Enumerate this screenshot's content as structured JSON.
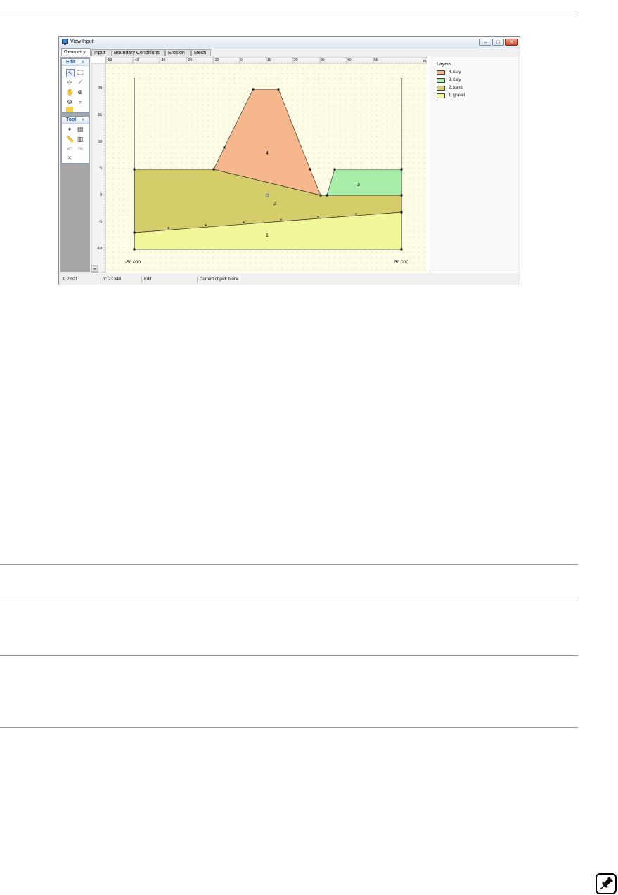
{
  "window": {
    "title": "View Input",
    "tabs": [
      "Geometry",
      "Input",
      "Boundary Conditions",
      "Erosion",
      "Mesh"
    ],
    "active_tab": "Geometry"
  },
  "toolbox": {
    "edit_label": "Edit",
    "tool_label": "Tool",
    "collapse_glyph": "«"
  },
  "ruler": {
    "x_ticks": [
      "-50",
      "-40",
      "-30",
      "-20",
      "-10",
      "0",
      "10",
      "20",
      "30",
      "40",
      "50"
    ],
    "x_unit": "m",
    "y_ticks": [
      "20",
      "15",
      "10",
      "5",
      "0",
      "-5",
      "-10"
    ],
    "corner_label": "m"
  },
  "geometry": {
    "left_limit_label": "-50.000",
    "right_limit_label": "50.000",
    "layer_numbers": [
      "4",
      "3",
      "2",
      "1"
    ]
  },
  "layers_panel": {
    "title": "Layers",
    "items": [
      {
        "label": "4. clay",
        "color": "#f7b78c"
      },
      {
        "label": "3. clay",
        "color": "#a8eea8"
      },
      {
        "label": "2. sand",
        "color": "#d4cd6a"
      },
      {
        "label": "1. gravel",
        "color": "#f2f79a"
      }
    ]
  },
  "status": {
    "x": "X: 7.021",
    "y": "Y: 23.848",
    "mode": "Edit",
    "current_object": "Current object: None"
  },
  "colors": {
    "clay4": "#f7b78c",
    "clay3": "#a8eea8",
    "sand": "#d4cd6a",
    "gravel": "#f2f79a",
    "canvas_bg": "#fcfde4"
  }
}
